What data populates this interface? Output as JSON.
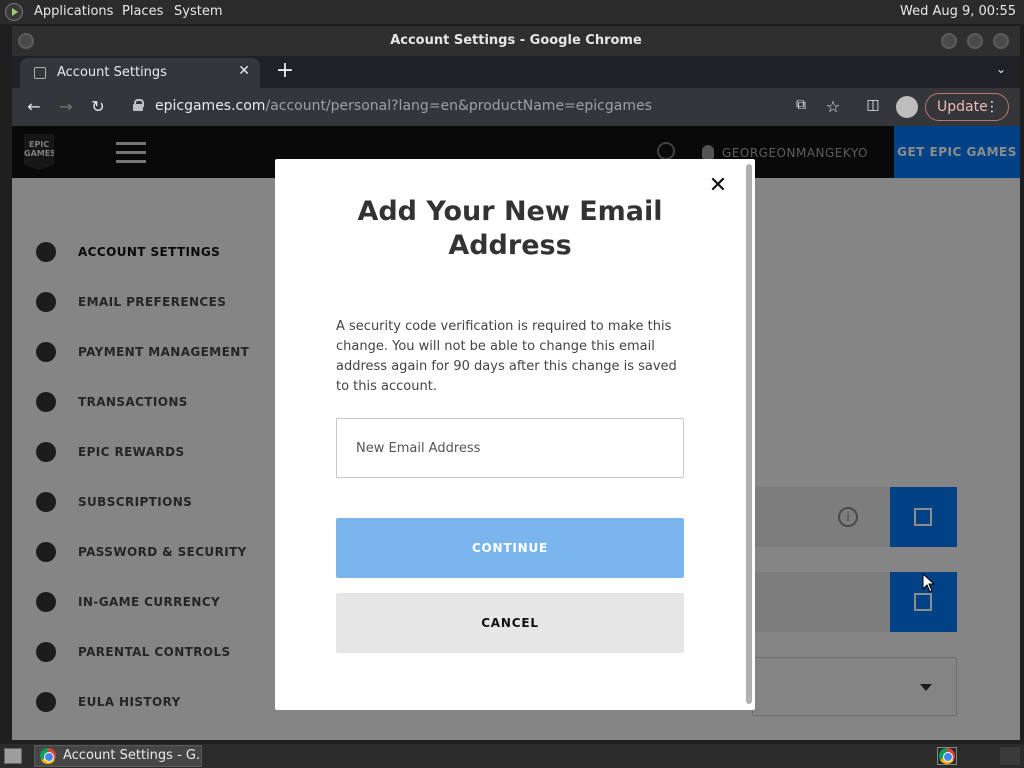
{
  "top_panel": {
    "menus": [
      "Applications",
      "Places",
      "System"
    ],
    "clock": "Wed Aug  9, 00:55"
  },
  "window": {
    "title": "Account Settings - Google Chrome"
  },
  "tab": {
    "title": "Account Settings",
    "close": "✕",
    "new_tab": "+",
    "tab_menu": "⌄"
  },
  "toolbar": {
    "url_domain": "epicgames.com",
    "url_rest": "/account/personal?lang=en&productName=epicgames",
    "update_label": "Update",
    "menu_dots": "⋮"
  },
  "header": {
    "logo_text": "EPIC GAMES",
    "username": "GEORGEONMANGEKYO",
    "get_epic": "GET EPIC GAMES"
  },
  "sidebar": {
    "items": [
      {
        "label": "ACCOUNT SETTINGS",
        "icon": "person-icon"
      },
      {
        "label": "EMAIL PREFERENCES",
        "icon": "bell-icon"
      },
      {
        "label": "PAYMENT MANAGEMENT",
        "icon": "dollar-icon"
      },
      {
        "label": "TRANSACTIONS",
        "icon": "clock-icon"
      },
      {
        "label": "EPIC REWARDS",
        "icon": "star-icon"
      },
      {
        "label": "SUBSCRIPTIONS",
        "icon": "home-gear-icon"
      },
      {
        "label": "PASSWORD & SECURITY",
        "icon": "lock-icon"
      },
      {
        "label": "IN-GAME CURRENCY",
        "icon": "currency-icon"
      },
      {
        "label": "PARENTAL CONTROLS",
        "icon": "shield-icon"
      },
      {
        "label": "EULA HISTORY",
        "icon": "document-icon"
      }
    ]
  },
  "modal": {
    "title": "Add Your New Email Address",
    "description": "A security code verification is required to make this change. You will not be able to change this email address again for 90 days after this change is saved to this account.",
    "input_placeholder": "New Email Address",
    "input_value": "",
    "continue_label": "CONTINUE",
    "cancel_label": "CANCEL",
    "close_glyph": "✕"
  },
  "taskbar": {
    "task_title": "Account Settings - G..."
  },
  "colors": {
    "accent": "#0078f2",
    "continue_disabled": "#7bb5ee",
    "update_text": "#f2b8b5"
  }
}
